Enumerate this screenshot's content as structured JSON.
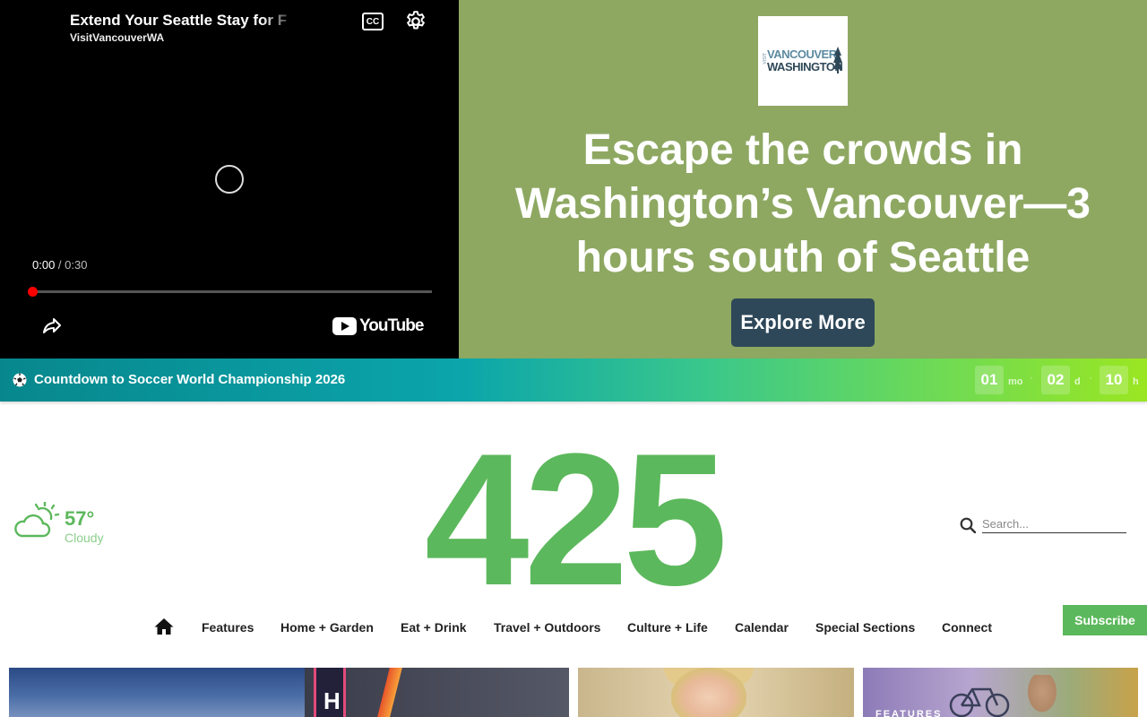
{
  "ad": {
    "video": {
      "title": "Extend Your Seattle Stay for F",
      "channel": "VisitVancouverWA",
      "cc_label": "CC",
      "time_current": "0:00",
      "time_separator": " / ",
      "time_duration": "0:30",
      "progress": 0,
      "brand": "YouTube",
      "icons": [
        "cc-icon",
        "gear-icon",
        "loading-spinner-icon",
        "share-icon",
        "youtube-logo-icon"
      ]
    },
    "logo": {
      "line_small": "VISIT",
      "line1": "VANCOUVER",
      "line2": "WASHINGTON",
      "icon": "pine-tree-icon"
    },
    "headline": "Escape the crowds in Washington’s Vancouver—3 hours south of Seattle",
    "cta_label": "Explore More",
    "background_color": "#8ea862",
    "cta_color": "#2e4859"
  },
  "countdown": {
    "icon": "soccer-ball-icon",
    "title": "Countdown to Soccer World Championship 2026",
    "units": [
      {
        "value": "01",
        "label": "mo"
      },
      {
        "value": "02",
        "label": "d"
      },
      {
        "value": "10",
        "label": "h"
      }
    ],
    "separator": "·"
  },
  "weather": {
    "icon": "partly-cloudy-icon",
    "temperature": "57°",
    "condition": "Cloudy"
  },
  "masthead": {
    "logo": "425",
    "brand_color": "#5cb85c"
  },
  "search": {
    "icon": "search-icon",
    "placeholder": "Search..."
  },
  "nav": {
    "home_icon": "home-icon",
    "items": [
      "Features",
      "Home + Garden",
      "Eat + Drink",
      "Travel + Outdoors",
      "Culture + Life",
      "Calendar",
      "Special Sections",
      "Connect"
    ]
  },
  "subscribe_label": "Subscribe",
  "cards": {
    "card3_tag": "FEATURES"
  }
}
